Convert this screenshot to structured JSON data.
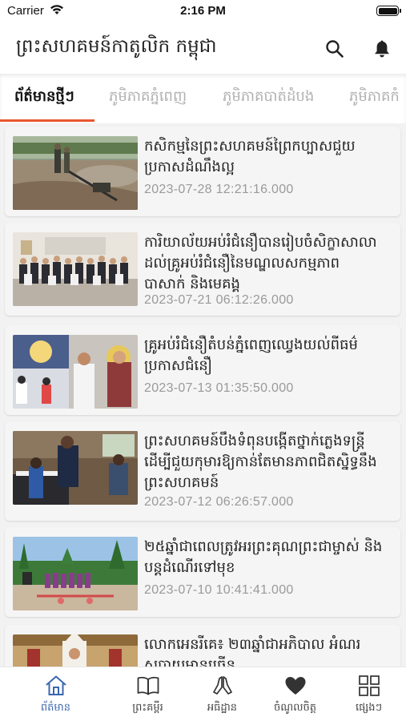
{
  "status": {
    "carrier": "Carrier",
    "time": "2:16 PM"
  },
  "header": {
    "title": "ព្រះសហគមន៍កាតូលិក កម្ពុជា",
    "icons": [
      "search-icon",
      "bell-icon"
    ]
  },
  "tabs": [
    {
      "label": "ព័ត៌មានថ្មីៗ",
      "active": true
    },
    {
      "label": "ភូមិភាគភ្នំពេញ",
      "active": false
    },
    {
      "label": "ភូមិភាគបាត់ដំបង",
      "active": false
    },
    {
      "label": "ភូមិភាគកំ",
      "active": false
    }
  ],
  "articles": [
    {
      "title_lines": [
        "កសិកម្មនៃព្រះសហគមន៍ព្រៃកប្បាសជួយ",
        "ប្រកាសដំណឹងល្អ"
      ],
      "date": "2023-07-28 12:21:16.000"
    },
    {
      "title_lines": [
        "ការិយាល័យអប់រំជំនឿបានរៀបចំសិក្ខាសាលា",
        "ដល់គ្រូអប់រំជំនឿនៃមណ្ឌលសកម្មភាព",
        "បាសាក់ និងមេគង្គ"
      ],
      "date": "2023-07-21 06:12:26.000"
    },
    {
      "title_lines": [
        "គ្រូអប់រំជំនឿតំបន់ភ្នំពេញឈ្វេងយល់ពីធម៌",
        "ប្រកាសជំនឿ"
      ],
      "date": "2023-07-13 01:35:50.000"
    },
    {
      "title_lines": [
        "ព្រះសហគមន៍បឹងទំពុនបង្កើតថ្នាក់ភ្លេងទន្ត្រី",
        "ដើម្បីជួយកុមារឱ្យកាន់តែមានភាពជិតស្និទ្ធនឹង",
        "ព្រះសហគមន៍"
      ],
      "date": "2023-07-12 06:26:57.000"
    },
    {
      "title_lines": [
        "២៥ឆ្នាំជាពេលត្រូវអរព្រះគុណព្រះជាម្ចាស់ និង",
        "បន្តដំណើរទៅមុខ"
      ],
      "date": "2023-07-10 10:41:41.000"
    },
    {
      "title_lines": [
        "លោកអេនរីគេ៖ ២៣ឆ្នាំជាអភិបាល អំណរ",
        "សបាយមានច្រើន"
      ],
      "date": ""
    }
  ],
  "bottom_nav": [
    {
      "label": "ព័ត៌មាន",
      "icon": "home-icon",
      "active": true
    },
    {
      "label": "ព្រះគម្ពីរ",
      "icon": "book-icon",
      "active": false
    },
    {
      "label": "អធិដ្ឋាន",
      "icon": "praying-hands-icon",
      "active": false
    },
    {
      "label": "ចំណូលចិត្ត",
      "icon": "heart-icon",
      "active": false
    },
    {
      "label": "ផ្សេងៗ",
      "icon": "grid-icon",
      "active": false
    }
  ],
  "colors": {
    "accent": "#e8562f",
    "nav_active": "#3c66b0"
  }
}
